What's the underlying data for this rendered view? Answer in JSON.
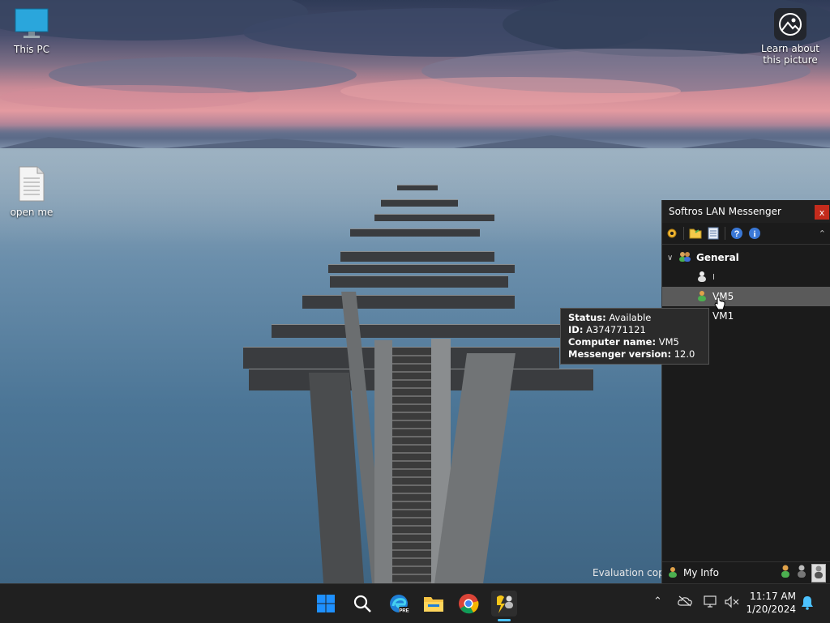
{
  "desktop": {
    "icons": [
      {
        "label": "This PC",
        "icon": "monitor-icon"
      },
      {
        "label": "open me",
        "icon": "text-file-icon"
      }
    ],
    "spotlight": {
      "label_line1": "Learn about",
      "label_line2": "this picture",
      "icon": "camera-icon"
    },
    "watermark": "Evaluation copy"
  },
  "lan_messenger": {
    "title": "Softros LAN Messenger",
    "close": "x",
    "toolbar_icons": [
      "settings-icon",
      "folder-icon",
      "notes-icon",
      "help-icon",
      "info-icon"
    ],
    "group": {
      "name": "General",
      "expanded": true
    },
    "users": [
      {
        "name": "I",
        "status": "offline"
      },
      {
        "name": "VM5",
        "status": "available",
        "selected": true
      },
      {
        "name": "VM1",
        "status": "pinned"
      }
    ],
    "status_bar": {
      "my_info": "My Info",
      "status_icons": [
        "available-status-icon",
        "away-status-icon",
        "busy-status-icon"
      ]
    }
  },
  "tooltip": {
    "status_label": "Status:",
    "status_value": "Available",
    "id_label": "ID:",
    "id_value": "A374771121",
    "computer_label": "Computer name:",
    "computer_value": "VM5",
    "version_label": "Messenger version:",
    "version_value": "12.0"
  },
  "taskbar": {
    "apps": [
      "windows-start-icon",
      "search-icon",
      "edge-beta-icon",
      "file-explorer-icon",
      "chrome-icon",
      "lan-messenger-icon"
    ],
    "active_app": "lan-messenger-icon",
    "tray_icons": [
      "chevron-up-icon",
      "onedrive-icon",
      "network-icon",
      "volume-muted-icon"
    ],
    "time": "11:17 AM",
    "date": "1/20/2024",
    "notification_icon": "bell-icon"
  },
  "colors": {
    "accent": "#0078d4",
    "close_red": "#c42b1c",
    "selected_row": "#5a5a5a"
  }
}
